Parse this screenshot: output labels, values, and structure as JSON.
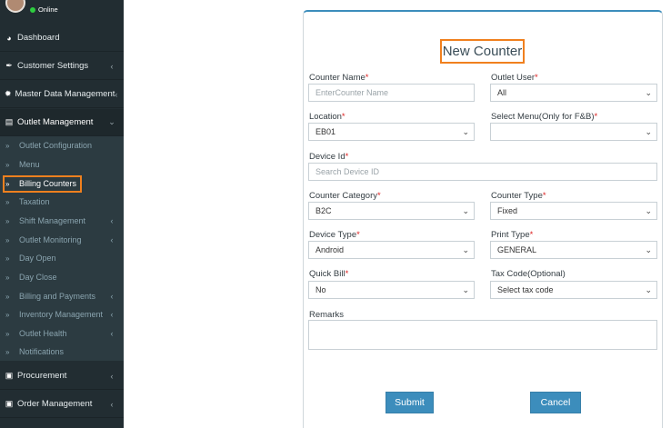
{
  "sidebar": {
    "status": "Online",
    "items": [
      {
        "label": "Dashboard",
        "icon": "dashboard-icon"
      },
      {
        "label": "Customer Settings",
        "icon": "wrench-icon"
      },
      {
        "label": "Master Data Management",
        "icon": "gear-icon"
      },
      {
        "label": "Outlet Management",
        "icon": "register-icon"
      }
    ],
    "submenu": [
      {
        "label": "Outlet Configuration"
      },
      {
        "label": "Menu"
      },
      {
        "label": "Billing Counters"
      },
      {
        "label": "Taxation"
      },
      {
        "label": "Shift Management"
      },
      {
        "label": "Outlet Monitoring"
      },
      {
        "label": "Day Open"
      },
      {
        "label": "Day Close"
      },
      {
        "label": "Billing and Payments"
      },
      {
        "label": "Inventory Management"
      },
      {
        "label": "Outlet Health"
      },
      {
        "label": "Notifications"
      }
    ],
    "bottom_items": [
      {
        "label": "Procurement",
        "icon": "cart-icon"
      },
      {
        "label": "Order Management",
        "icon": "cart-icon"
      }
    ]
  },
  "form": {
    "title": "New Counter",
    "counter_name": {
      "label": "Counter Name",
      "placeholder": "EnterCounter Name"
    },
    "outlet_user": {
      "label": "Outlet User",
      "value": "All"
    },
    "location": {
      "label": "Location",
      "value": "EB01"
    },
    "select_menu": {
      "label": "Select Menu(Only for F&B)",
      "value": ""
    },
    "device_id": {
      "label": "Device Id",
      "placeholder": "Search Device ID"
    },
    "counter_category": {
      "label": "Counter Category",
      "value": "B2C"
    },
    "counter_type": {
      "label": "Counter Type",
      "value": "Fixed"
    },
    "device_type": {
      "label": "Device Type",
      "value": "Android"
    },
    "print_type": {
      "label": "Print Type",
      "value": "GENERAL"
    },
    "quick_bill": {
      "label": "Quick Bill",
      "value": "No"
    },
    "tax_code": {
      "label": "Tax Code(Optional)",
      "value": "Select tax code"
    },
    "remarks": {
      "label": "Remarks"
    },
    "submit_label": "Submit",
    "cancel_label": "Cancel",
    "required_mark": "*"
  },
  "colors": {
    "sidebar_bg": "#222d32",
    "submenu_bg": "#2c3b41",
    "accent": "#3c8dbc",
    "highlight": "#f0801e",
    "required": "#dd2222"
  }
}
